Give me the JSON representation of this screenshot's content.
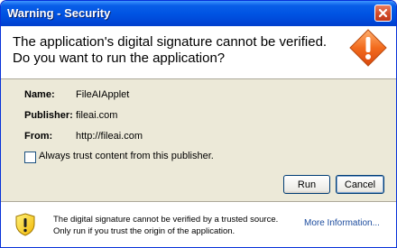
{
  "window": {
    "title": "Warning - Security"
  },
  "header": {
    "headline": "The application's digital signature cannot be verified.\nDo you want to run the application?"
  },
  "details": [
    {
      "label": "Name:",
      "value": "FileAIApplet"
    },
    {
      "label": "Publisher:",
      "value": "fileai.com"
    },
    {
      "label": "From:",
      "value": "http://fileai.com"
    }
  ],
  "trust": {
    "label": "Always trust content from this publisher.",
    "checked": false
  },
  "buttons": {
    "run": "Run",
    "cancel": "Cancel"
  },
  "footer": {
    "text": "The digital signature cannot be verified by a trusted source.  Only run if you trust the origin of the application.",
    "more_info": "More Information..."
  },
  "colors": {
    "titlebar": "#0054e3",
    "dialog_bg": "#ece9d8",
    "warning_orange": "#f26b1d",
    "link": "#1c4c9e"
  }
}
